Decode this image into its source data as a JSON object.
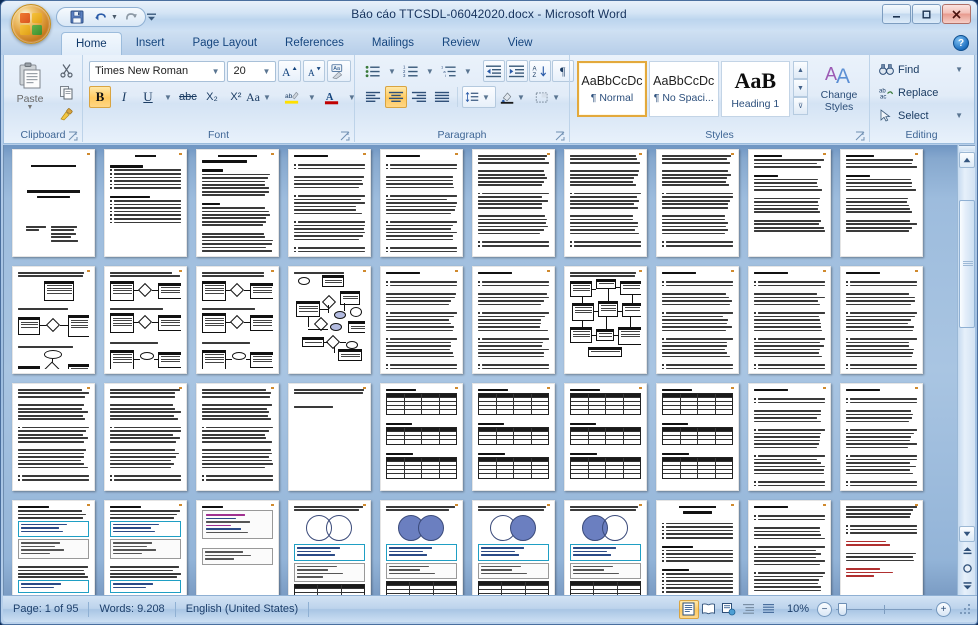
{
  "window": {
    "title": "Báo cáo TTCSDL-06042020.docx - Microsoft Word",
    "minimize_label": "—",
    "maximize_label": "❐",
    "close_label": "✕"
  },
  "quick_access": {
    "office_button": "office-button",
    "items": [
      {
        "name": "save",
        "label": "Save",
        "icon": "save-icon"
      },
      {
        "name": "undo",
        "label": "Undo",
        "icon": "undo-icon"
      },
      {
        "name": "redo",
        "label": "Redo",
        "icon": "redo-icon"
      }
    ],
    "customize_label": "Customize Quick Access Toolbar"
  },
  "ribbon": {
    "tabs": [
      {
        "label": "Home",
        "active": true
      },
      {
        "label": "Insert",
        "active": false
      },
      {
        "label": "Page Layout",
        "active": false
      },
      {
        "label": "References",
        "active": false
      },
      {
        "label": "Mailings",
        "active": false
      },
      {
        "label": "Review",
        "active": false
      },
      {
        "label": "View",
        "active": false
      }
    ],
    "help_label": "?",
    "groups": {
      "clipboard": {
        "label": "Clipboard",
        "paste_label": "Paste",
        "cut_label": "Cut",
        "copy_label": "Copy",
        "format_painter_label": "Format Painter"
      },
      "font": {
        "label": "Font",
        "font_name": "Times New Roman",
        "font_size": "20",
        "grow_font_label": "Grow Font",
        "shrink_font_label": "Shrink Font",
        "clear_formatting_label": "Clear Formatting",
        "bold_label": "B",
        "italic_label": "I",
        "underline_label": "U",
        "strikethrough_label": "abc",
        "subscript_label": "X₂",
        "superscript_label": "X²",
        "change_case_label": "Aa",
        "highlight_label": "Text Highlight Color",
        "font_color_label": "A",
        "bold_active": true
      },
      "paragraph": {
        "label": "Paragraph",
        "bullets_label": "Bullets",
        "numbering_label": "Numbering",
        "multilevel_label": "Multilevel List",
        "decrease_indent_label": "Decrease Indent",
        "increase_indent_label": "Increase Indent",
        "sort_label": "Sort",
        "show_marks_label": "¶",
        "align_left_label": "Align Left",
        "center_label": "Center",
        "align_right_label": "Align Right",
        "justify_label": "Justify",
        "line_spacing_label": "Line Spacing",
        "shading_label": "Shading",
        "borders_label": "Borders",
        "center_active": true
      },
      "styles": {
        "label": "Styles",
        "items": [
          {
            "preview": "AaBbCcDc",
            "name": "¶ Normal",
            "selected": true
          },
          {
            "preview": "AaBbCcDc",
            "name": "¶ No Spaci...",
            "selected": false
          },
          {
            "preview": "AaB",
            "name": "Heading 1",
            "selected": false
          }
        ],
        "change_styles_line1": "Change",
        "change_styles_line2": "Styles"
      },
      "editing": {
        "label": "Editing",
        "items": [
          {
            "label": "Find",
            "icon": "binoculars-icon",
            "has_caret": true
          },
          {
            "label": "Replace",
            "icon": "replace-icon",
            "has_caret": false
          },
          {
            "label": "Select",
            "icon": "cursor-icon",
            "has_caret": true
          }
        ]
      }
    }
  },
  "status_bar": {
    "page_info": "Page: 1 of 95",
    "word_count": "Words: 9.208",
    "language": "English (United States)",
    "zoom_level": "10%",
    "zoom_out_label": "−",
    "zoom_in_label": "+",
    "view_buttons": [
      {
        "name": "print-layout",
        "label": "Print Layout",
        "active": true
      },
      {
        "name": "full-screen-reading",
        "label": "Full Screen Reading",
        "active": false
      },
      {
        "name": "web-layout",
        "label": "Web Layout",
        "active": false
      },
      {
        "name": "outline",
        "label": "Outline",
        "active": false
      },
      {
        "name": "draft",
        "label": "Draft",
        "active": false
      }
    ]
  },
  "scrollbar": {
    "split_label": "Split",
    "up_label": "▲",
    "down_label": "▼",
    "previous_page_label": "Previous Page",
    "browse_object_label": "Select Browse Object",
    "next_page_label": "Next Page"
  },
  "document": {
    "zoom": "10%",
    "total_pages": 95,
    "visible_pages": 40,
    "pages": [
      {
        "n": 1,
        "kind": "cover"
      },
      {
        "n": 2,
        "kind": "toc"
      },
      {
        "n": 3,
        "kind": "text-heavy"
      },
      {
        "n": 4,
        "kind": "text-bullets"
      },
      {
        "n": 5,
        "kind": "text-bullets"
      },
      {
        "n": 6,
        "kind": "text-paras"
      },
      {
        "n": 7,
        "kind": "text-paras"
      },
      {
        "n": 8,
        "kind": "text-paras"
      },
      {
        "n": 9,
        "kind": "text-tables"
      },
      {
        "n": 10,
        "kind": "text-tables"
      },
      {
        "n": 11,
        "kind": "er-small"
      },
      {
        "n": 12,
        "kind": "er-rows"
      },
      {
        "n": 13,
        "kind": "er-rows"
      },
      {
        "n": 14,
        "kind": "er-large"
      },
      {
        "n": 15,
        "kind": "text-bullets"
      },
      {
        "n": 16,
        "kind": "text-bullets"
      },
      {
        "n": 17,
        "kind": "schema-boxes"
      },
      {
        "n": 18,
        "kind": "text-bullets"
      },
      {
        "n": 19,
        "kind": "text-bullets"
      },
      {
        "n": 20,
        "kind": "text-bullets"
      },
      {
        "n": 21,
        "kind": "text-paras"
      },
      {
        "n": 22,
        "kind": "text-paras"
      },
      {
        "n": 23,
        "kind": "text-paras"
      },
      {
        "n": 24,
        "kind": "sparse"
      },
      {
        "n": 25,
        "kind": "tables"
      },
      {
        "n": 26,
        "kind": "tables"
      },
      {
        "n": 27,
        "kind": "tables"
      },
      {
        "n": 28,
        "kind": "tables"
      },
      {
        "n": 29,
        "kind": "text-bullets"
      },
      {
        "n": 30,
        "kind": "text-bullets"
      },
      {
        "n": 31,
        "kind": "code-cyan"
      },
      {
        "n": 32,
        "kind": "code-cyan"
      },
      {
        "n": 33,
        "kind": "code-color"
      },
      {
        "n": 34,
        "kind": "venn-empty"
      },
      {
        "n": 35,
        "kind": "venn-both"
      },
      {
        "n": 36,
        "kind": "venn-right"
      },
      {
        "n": 37,
        "kind": "venn-left"
      },
      {
        "n": 38,
        "kind": "heading-list"
      },
      {
        "n": 39,
        "kind": "text-bullets"
      },
      {
        "n": 40,
        "kind": "text-red"
      }
    ]
  },
  "colors": {
    "accent": "#15457e",
    "ribbon_bg": "#e2ecf8",
    "highlight": "#ffc95f",
    "doc_bg": "#a9c5e2",
    "cyan_box": "#1f9fc4"
  }
}
